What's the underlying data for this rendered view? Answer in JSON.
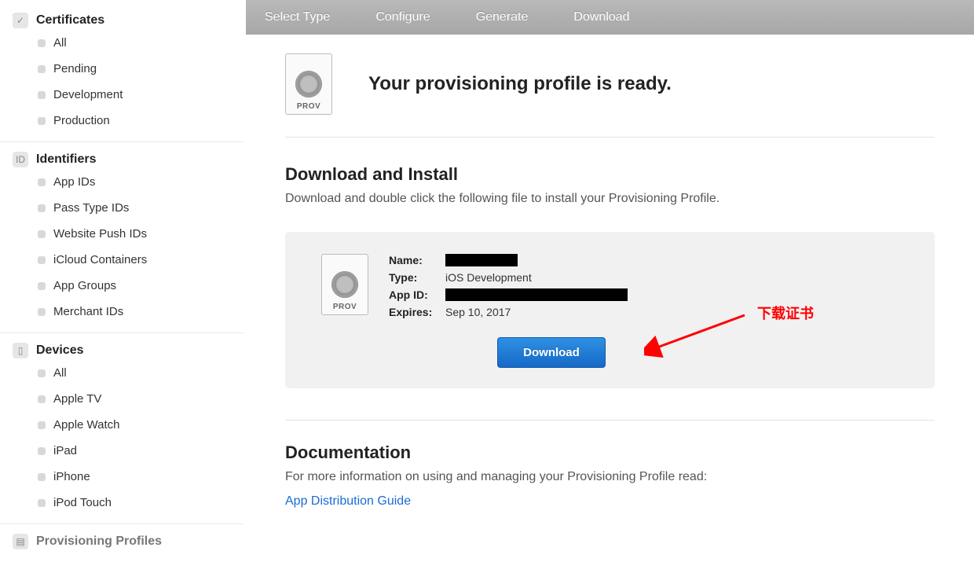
{
  "steps": [
    "Select Type",
    "Configure",
    "Generate",
    "Download"
  ],
  "sidebar": [
    {
      "title": "Certificates",
      "icon": "cert",
      "items": [
        "All",
        "Pending",
        "Development",
        "Production"
      ]
    },
    {
      "title": "Identifiers",
      "icon": "id",
      "items": [
        "App IDs",
        "Pass Type IDs",
        "Website Push IDs",
        "iCloud Containers",
        "App Groups",
        "Merchant IDs"
      ]
    },
    {
      "title": "Devices",
      "icon": "dev",
      "items": [
        "All",
        "Apple TV",
        "Apple Watch",
        "iPad",
        "iPhone",
        "iPod Touch"
      ]
    },
    {
      "title": "Provisioning Profiles",
      "icon": "prov",
      "items": []
    }
  ],
  "hero": {
    "title": "Your provisioning profile is ready.",
    "iconLabel": "PROV"
  },
  "section1": {
    "heading": "Download and Install",
    "sub": "Download and double click the following file to install your Provisioning Profile."
  },
  "profile": {
    "nameLabel": "Name:",
    "nameRedacted": true,
    "typeLabel": "Type:",
    "typeValue": "iOS Development",
    "appIdLabel": "App ID:",
    "appIdRedacted": true,
    "expiresLabel": "Expires:",
    "expiresValue": "Sep 10, 2017",
    "downloadButton": "Download"
  },
  "annotation": {
    "text": "下载证书"
  },
  "section2": {
    "heading": "Documentation",
    "sub": "For more information on using and managing your Provisioning Profile read:",
    "link": "App Distribution Guide"
  }
}
